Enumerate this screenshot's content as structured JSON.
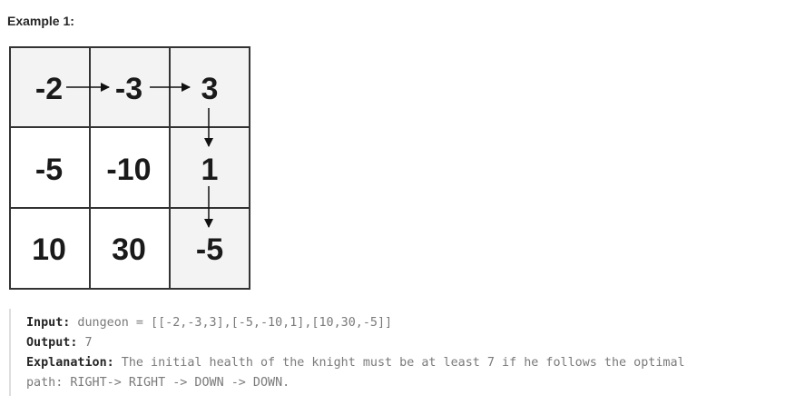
{
  "heading": "Example 1:",
  "grid": {
    "rows": [
      [
        "-2",
        "-3",
        "3"
      ],
      [
        "-5",
        "-10",
        "1"
      ],
      [
        "10",
        "30",
        "-5"
      ]
    ],
    "path": [
      [
        0,
        0
      ],
      [
        0,
        1
      ],
      [
        0,
        2
      ],
      [
        1,
        2
      ],
      [
        2,
        2
      ]
    ],
    "path_color": "#f3f3f3",
    "cell_color": "#ffffff",
    "border_color": "#333333"
  },
  "example": {
    "input_label": "Input:",
    "input_value": " dungeon = [[-2,-3,3],[-5,-10,1],[10,30,-5]]",
    "output_label": "Output:",
    "output_value": " 7",
    "explanation_label": "Explanation:",
    "explanation_line1": " The initial health of the knight must be at least 7 if he follows the optimal",
    "explanation_line2": "path: RIGHT-> RIGHT -> DOWN -> DOWN."
  }
}
